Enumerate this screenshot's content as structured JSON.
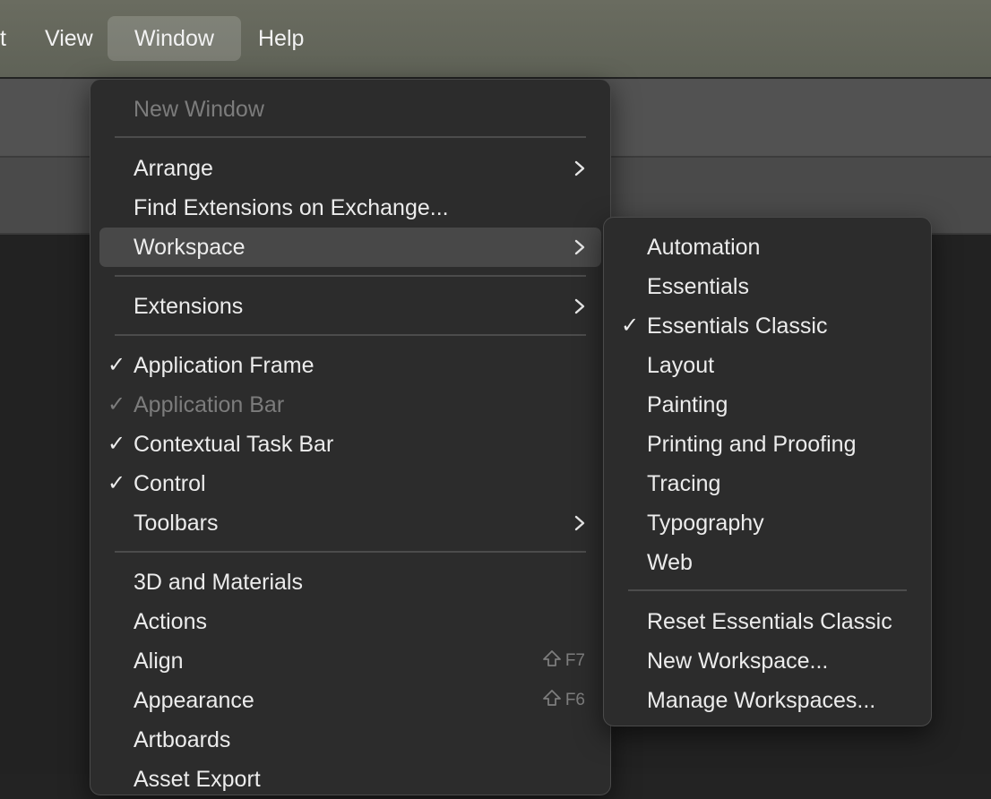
{
  "menubar": {
    "items": [
      {
        "label": "t"
      },
      {
        "label": "View"
      },
      {
        "label": "Window"
      },
      {
        "label": "Help"
      }
    ]
  },
  "window_menu": {
    "new_window": "New Window",
    "arrange": "Arrange",
    "find_extensions": "Find Extensions on Exchange...",
    "workspace": "Workspace",
    "extensions": "Extensions",
    "application_frame": "Application Frame",
    "application_bar": "Application Bar",
    "contextual_task_bar": "Contextual Task Bar",
    "control": "Control",
    "toolbars": "Toolbars",
    "materials_3d": "3D and Materials",
    "actions": "Actions",
    "align": "Align",
    "align_shortcut": "F7",
    "appearance": "Appearance",
    "appearance_shortcut": "F6",
    "artboards": "Artboards",
    "asset_export": "Asset Export"
  },
  "workspace_menu": {
    "automation": "Automation",
    "essentials": "Essentials",
    "essentials_classic": "Essentials Classic",
    "layout": "Layout",
    "painting": "Painting",
    "printing_proofing": "Printing and Proofing",
    "tracing": "Tracing",
    "typography": "Typography",
    "web": "Web",
    "reset": "Reset Essentials Classic",
    "new_workspace": "New Workspace...",
    "manage": "Manage Workspaces..."
  },
  "glyphs": {
    "check": "✓",
    "chevron_icon": "chevron-right-icon",
    "shift_icon": "shift-key-icon"
  },
  "colors": {
    "menu_bg": "#2c2c2c",
    "highlight": "#484848",
    "menubar_bg": "#63665b"
  }
}
